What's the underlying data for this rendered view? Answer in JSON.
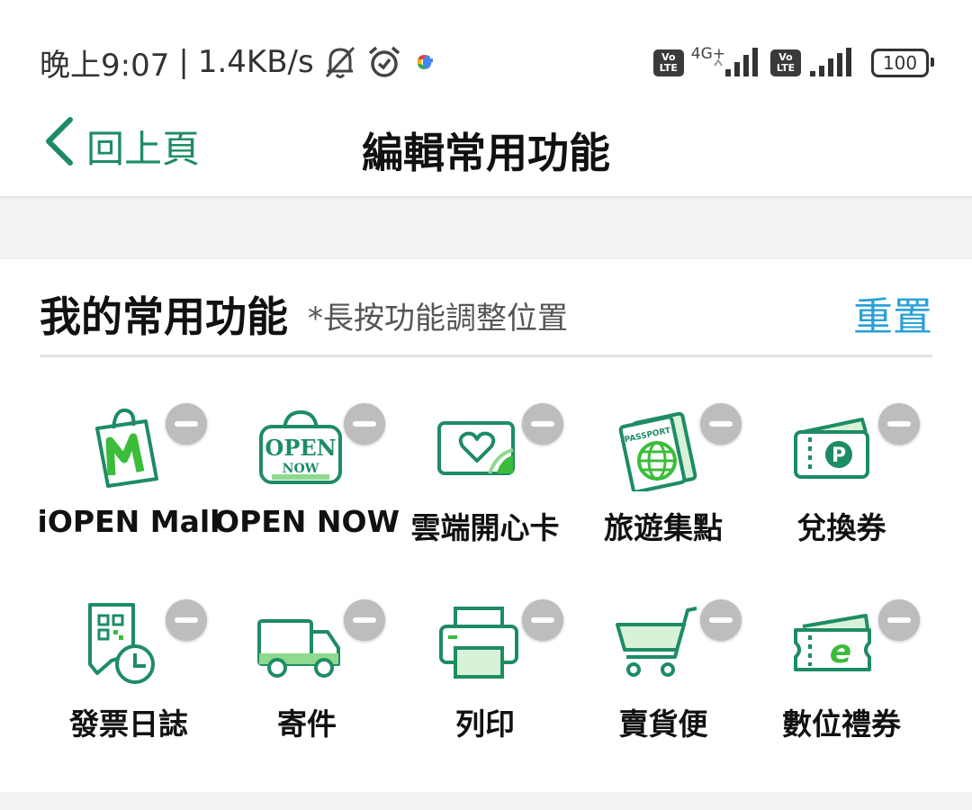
{
  "status_bar": {
    "time": "晚上9:07",
    "speed": "1.4KB/s",
    "network": "4G+",
    "volte_label": "Vo LTE",
    "battery": "100",
    "icons": [
      "bell-off-icon",
      "alarm-icon",
      "google-icon",
      "signal-icon",
      "battery-icon"
    ]
  },
  "header": {
    "back_label": "回上頁",
    "title": "編輯常用功能"
  },
  "section": {
    "title": "我的常用功能",
    "hint": "*長按功能調整位置",
    "reset_label": "重置"
  },
  "colors": {
    "accent_green": "#1e8c63",
    "light_green": "#8fd88f",
    "link_blue": "#2aa0d8",
    "remove_gray": "#bdbdbd"
  },
  "functions": [
    {
      "label": "iOPEN Mall",
      "icon": "shopping-bag-m-icon"
    },
    {
      "label": "OPEN NOW",
      "icon": "open-now-bag-icon",
      "icon_text": "OPEN",
      "icon_subtext": "NOW"
    },
    {
      "label": "雲端開心卡",
      "icon": "heart-card-icon"
    },
    {
      "label": "旅遊集點",
      "icon": "passport-icon",
      "icon_text": "PASSPORT"
    },
    {
      "label": "兌換券",
      "icon": "p-ticket-icon",
      "icon_text": "P"
    },
    {
      "label": "發票日誌",
      "icon": "receipt-clock-icon"
    },
    {
      "label": "寄件",
      "icon": "delivery-truck-icon"
    },
    {
      "label": "列印",
      "icon": "printer-icon"
    },
    {
      "label": "賣貨便",
      "icon": "shopping-cart-icon"
    },
    {
      "label": "數位禮券",
      "icon": "e-voucher-icon",
      "icon_text": "e"
    }
  ]
}
